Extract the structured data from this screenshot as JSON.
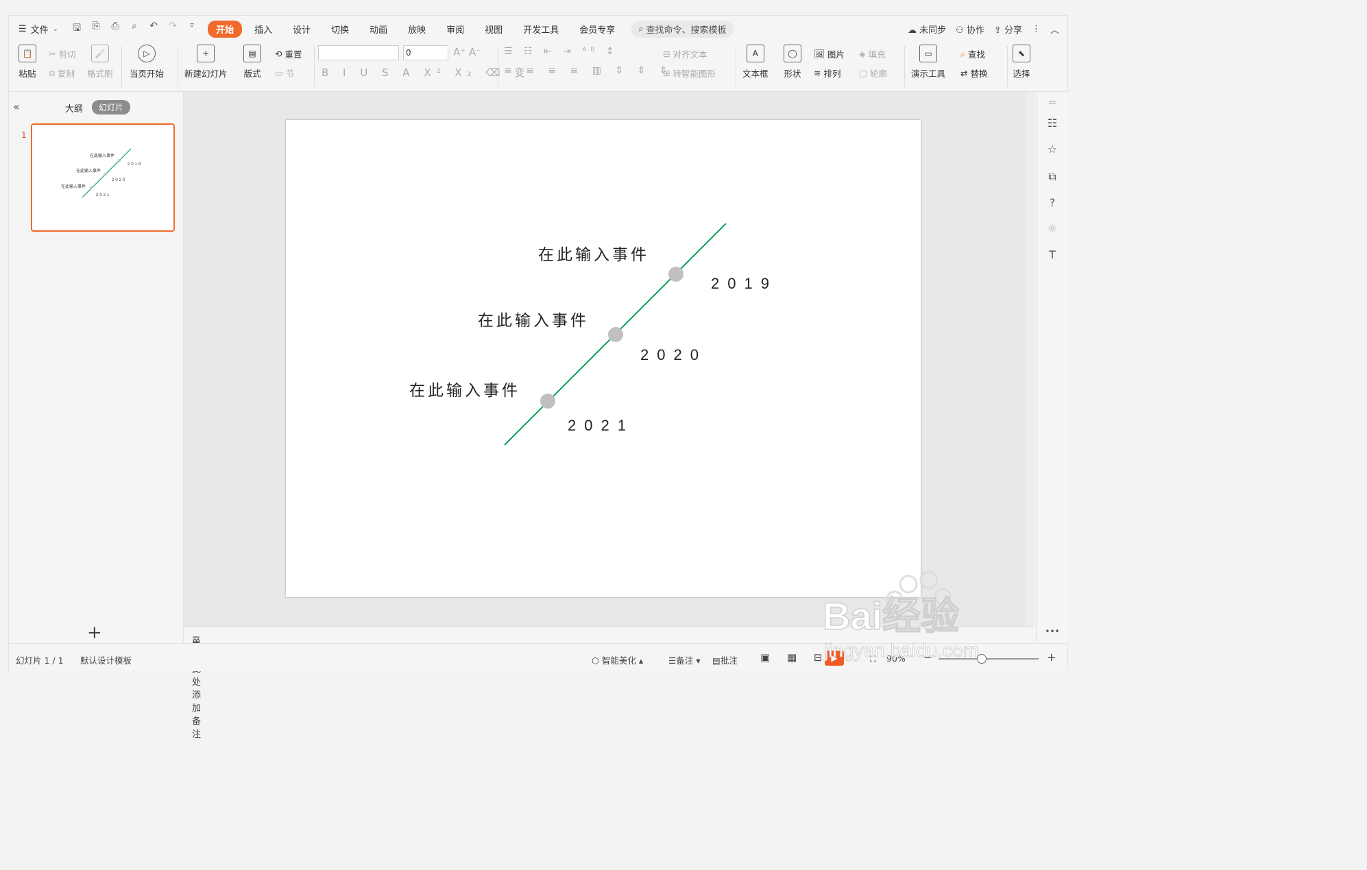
{
  "menubar": {
    "file": "文件",
    "tabs": [
      "开始",
      "插入",
      "设计",
      "切换",
      "动画",
      "放映",
      "审阅",
      "视图",
      "开发工具",
      "会员专享"
    ],
    "search_placeholder": "查找命令、搜索模板",
    "sync": "未同步",
    "collab": "协作",
    "share": "分享"
  },
  "ribbon": {
    "paste": "粘贴",
    "cut": "剪切",
    "copy": "复制",
    "format_painter": "格式刷",
    "from_current": "当页开始",
    "new_slide": "新建幻灯片",
    "layout": "版式",
    "reset": "重置",
    "section": "节",
    "font_size": "0",
    "align_text": "对齐文本",
    "smartart": "转智能图形",
    "textbox": "文本框",
    "shape": "形状",
    "picture": "图片",
    "arrange": "排列",
    "fill": "填充",
    "outline": "轮廓",
    "present_tools": "演示工具",
    "find": "查找",
    "replace": "替换",
    "select": "选择"
  },
  "leftpanel": {
    "outline_tab": "大纲",
    "slides_tab": "幻灯片",
    "slide_number": "1",
    "add": "+"
  },
  "slide": {
    "events": [
      "在此输入事件",
      "在此输入事件",
      "在此输入事件"
    ],
    "years": [
      "2019",
      "2020",
      "2021"
    ],
    "line_color": "#1aa260",
    "dot_color": "#c0c0c0"
  },
  "notes": {
    "placeholder": "单击此处添加备注"
  },
  "status": {
    "slide_counter": "幻灯片 1 / 1",
    "template": "默认设计模板",
    "beautify": "智能美化",
    "notes": "备注",
    "comments": "批注",
    "zoom": "90%"
  },
  "watermark": {
    "brand": "Bai经验",
    "url": "jingyan.baidu.com"
  }
}
